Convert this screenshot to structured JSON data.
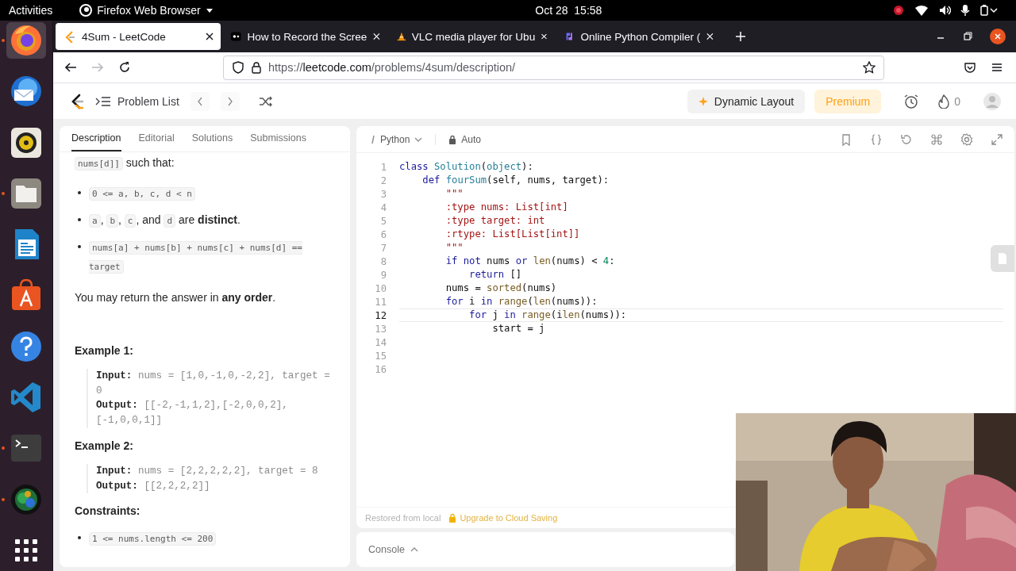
{
  "topbar": {
    "activities": "Activities",
    "app_menu": "Firefox Web Browser",
    "clock": "Oct 28  15:58"
  },
  "dock": [
    {
      "kind": "browser",
      "running": true,
      "selected": true
    },
    {
      "kind": "mail",
      "running": false,
      "selected": false
    },
    {
      "kind": "speaker",
      "running": false,
      "selected": false
    },
    {
      "kind": "folder",
      "running": true,
      "selected": false
    },
    {
      "kind": "document",
      "running": false,
      "selected": false
    },
    {
      "kind": "store",
      "running": false,
      "selected": false
    },
    {
      "kind": "help",
      "running": false,
      "selected": false
    },
    {
      "kind": "code",
      "running": false,
      "selected": false
    },
    {
      "kind": "terminal",
      "running": true,
      "selected": false
    },
    {
      "kind": "camera",
      "running": true,
      "selected": false
    },
    {
      "kind": "apps",
      "running": false,
      "selected": false
    }
  ],
  "browser": {
    "tabs": [
      {
        "title": "4Sum - LeetCode",
        "kind": "leetcode",
        "selected": true
      },
      {
        "title": "How to Record the Scree",
        "kind": "video",
        "selected": false
      },
      {
        "title": "VLC media player for Ubu",
        "kind": "cone",
        "selected": false
      },
      {
        "title": "Online Python Compiler (",
        "kind": "python",
        "selected": false
      }
    ],
    "url": {
      "scheme": "https://",
      "host": "leetcode.com",
      "path": "/problems/4sum/description/"
    }
  },
  "header": {
    "problem_list": "Problem List",
    "dynamic_layout": "Dynamic Layout",
    "premium": "Premium",
    "streak": "0"
  },
  "description": {
    "tabs": [
      {
        "label": "Description",
        "selected": true
      },
      {
        "label": "Editorial",
        "selected": false
      },
      {
        "label": "Solutions",
        "selected": false
      },
      {
        "label": "Submissions",
        "selected": false
      }
    ],
    "blocks": [
      {
        "kind": "para",
        "segments": [
          {
            "kind": "code",
            "text": "nums[d]]"
          },
          {
            "kind": "text",
            "text": " such that:"
          }
        ]
      },
      {
        "kind": "bullets",
        "items": [
          {
            "segments": [
              {
                "kind": "code",
                "text": "0 <= a, b, c, d < n"
              }
            ]
          },
          {
            "segments": [
              {
                "kind": "code",
                "text": "a"
              },
              {
                "kind": "text",
                "text": ", "
              },
              {
                "kind": "code",
                "text": "b"
              },
              {
                "kind": "text",
                "text": ", "
              },
              {
                "kind": "code",
                "text": "c"
              },
              {
                "kind": "text",
                "text": ", and "
              },
              {
                "kind": "code",
                "text": "d"
              },
              {
                "kind": "text",
                "text": " are **distinct**."
              }
            ]
          },
          {
            "segments": [
              {
                "kind": "code",
                "text": "nums[a] + nums[b] + nums[c] + nums[d] == target"
              }
            ]
          }
        ]
      },
      {
        "kind": "para",
        "segments": [
          {
            "kind": "text",
            "text": "You may return the answer in **any order**."
          }
        ]
      },
      {
        "kind": "heading",
        "text": "Example 1:"
      },
      {
        "kind": "example",
        "lines": [
          {
            "label": "Input:",
            "value": "nums = [1,0,-1,0,-2,2], target = 0"
          },
          {
            "label": "Output:",
            "value": "[[-2,-1,1,2],[-2,0,0,2],[-1,0,0,1]]"
          }
        ]
      },
      {
        "kind": "heading",
        "text": "Example 2:"
      },
      {
        "kind": "example",
        "lines": [
          {
            "label": "Input:",
            "value": "nums = [2,2,2,2,2], target = 8"
          },
          {
            "label": "Output:",
            "value": "[[2,2,2,2]]"
          }
        ]
      },
      {
        "kind": "heading",
        "text": "Constraints:"
      },
      {
        "kind": "bullets",
        "items": [
          {
            "segments": [
              {
                "kind": "code",
                "text": "1 <= nums.length <= 200"
              }
            ]
          }
        ]
      }
    ]
  },
  "editor": {
    "language": "Python",
    "mode": "Auto",
    "lines": [
      {
        "number": "1",
        "current": false,
        "tokens": [
          {
            "kind": "kw",
            "text": "class"
          },
          {
            "kind": "type",
            "text": " Solution"
          },
          {
            "kind": "plain",
            "text": "("
          },
          {
            "kind": "type",
            "text": "object"
          },
          {
            "kind": "plain",
            "text": "):"
          }
        ]
      },
      {
        "number": "2",
        "current": false,
        "tokens": [
          {
            "kind": "kw",
            "text": "    def"
          },
          {
            "kind": "type",
            "text": " fourSum"
          },
          {
            "kind": "plain",
            "text": "(self, nums, target):"
          }
        ]
      },
      {
        "number": "3",
        "current": false,
        "tokens": [
          {
            "kind": "str",
            "text": "        \"\"\""
          }
        ]
      },
      {
        "number": "4",
        "current": false,
        "tokens": [
          {
            "kind": "str",
            "text": "        :type nums: List[int]"
          }
        ]
      },
      {
        "number": "5",
        "current": false,
        "tokens": [
          {
            "kind": "str",
            "text": "        :type target: int"
          }
        ]
      },
      {
        "number": "6",
        "current": false,
        "tokens": [
          {
            "kind": "str",
            "text": "        :rtype: List[List[int]]"
          }
        ]
      },
      {
        "number": "7",
        "current": false,
        "tokens": [
          {
            "kind": "str",
            "text": "        \"\"\""
          }
        ]
      },
      {
        "number": "8",
        "current": false,
        "tokens": [
          {
            "kind": "kw",
            "text": "        if not"
          },
          {
            "kind": "plain",
            "text": " nums "
          },
          {
            "kind": "kw",
            "text": "or"
          },
          {
            "kind": "builtin",
            "text": " len"
          },
          {
            "kind": "plain",
            "text": "(nums) < "
          },
          {
            "kind": "num",
            "text": "4"
          },
          {
            "kind": "plain",
            "text": ":"
          }
        ]
      },
      {
        "number": "9",
        "current": false,
        "tokens": [
          {
            "kind": "kw",
            "text": "            return"
          },
          {
            "kind": "plain",
            "text": " []"
          }
        ]
      },
      {
        "number": "10",
        "current": false,
        "tokens": [
          {
            "kind": "plain",
            "text": "        nums = "
          },
          {
            "kind": "builtin",
            "text": "sorted"
          },
          {
            "kind": "plain",
            "text": "(nums)"
          }
        ]
      },
      {
        "number": "11",
        "current": false,
        "tokens": [
          {
            "kind": "kw",
            "text": "        for"
          },
          {
            "kind": "plain",
            "text": " i "
          },
          {
            "kind": "kw",
            "text": "in"
          },
          {
            "kind": "builtin",
            "text": " range"
          },
          {
            "kind": "plain",
            "text": "("
          },
          {
            "kind": "builtin",
            "text": "len"
          },
          {
            "kind": "plain",
            "text": "(nums)):"
          }
        ]
      },
      {
        "number": "12",
        "current": true,
        "tokens": [
          {
            "kind": "kw",
            "text": "            for"
          },
          {
            "kind": "plain",
            "text": " j "
          },
          {
            "kind": "kw",
            "text": "in"
          },
          {
            "kind": "builtin",
            "text": " range"
          },
          {
            "kind": "plain",
            "text": "(i"
          },
          {
            "kind": "builtin",
            "text": "len"
          },
          {
            "kind": "plain",
            "text": "(nums)):"
          }
        ]
      },
      {
        "number": "13",
        "current": false,
        "tokens": [
          {
            "kind": "plain",
            "text": "                start = j"
          }
        ]
      },
      {
        "number": "14",
        "current": false
      },
      {
        "number": "15",
        "current": false
      },
      {
        "number": "16",
        "current": false
      }
    ],
    "status": "Restored from local",
    "upgrade": "Upgrade to Cloud Saving",
    "console": "Console"
  }
}
